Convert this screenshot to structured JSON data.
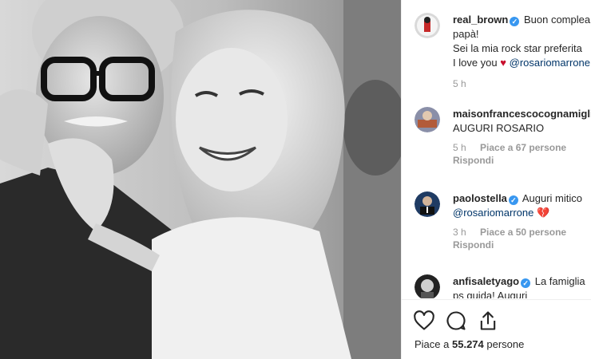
{
  "caption": {
    "username": "real_brown",
    "lines": [
      "Buon compleanno",
      "papà!",
      "Sei la mia rock star preferita",
      "I love you"
    ],
    "mention": "@rosariomarrone",
    "time": "5 h"
  },
  "comments": [
    {
      "username": "maisonfrancescocognamiglio",
      "text": "AUGURI ROSARIO",
      "time": "5 h",
      "likes": "Piace a 67 persone",
      "reply": "Rispondi"
    },
    {
      "username": "paolostella",
      "text": "Auguri mitico",
      "mention": "@rosariomarrone",
      "time": "3 h",
      "likes": "Piace a 50 persone",
      "reply": "Rispondi"
    },
    {
      "username": "anfisaletyago",
      "text": "La famiglia",
      "text2": "ps guida! Auguri"
    }
  ],
  "footer": {
    "likes_prefix": "Piace a",
    "likes_count": "55.274",
    "likes_suffix": "persone"
  },
  "colors": {
    "verified": "#3897f0",
    "mention": "#003569",
    "heart": "#c8102e",
    "muted": "#999999"
  },
  "icons": [
    "heart-outline-icon",
    "comment-icon",
    "share-icon",
    "verified-badge-icon",
    "red-heart-icon",
    "broken-heart-icon"
  ]
}
